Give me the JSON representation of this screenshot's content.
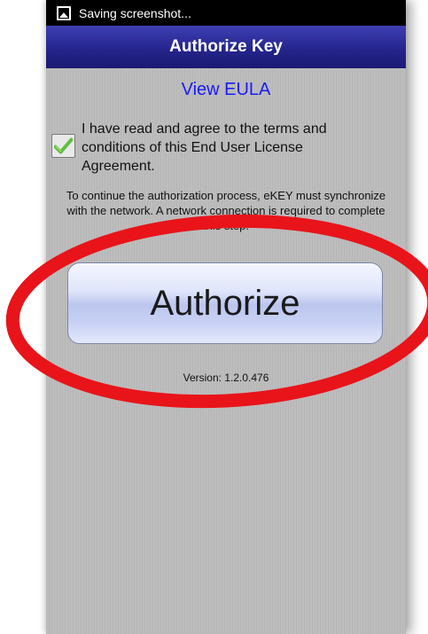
{
  "status_bar": {
    "text": "Saving screenshot...",
    "icon": "screenshot-icon"
  },
  "header": {
    "title": "Authorize Key"
  },
  "eula": {
    "link_label": "View EULA"
  },
  "agreement": {
    "checked": true,
    "text": "I have read and agree to the terms and conditions of this End User License Agreement."
  },
  "info": {
    "text": "To continue the authorization process, eKEY must synchronize with the network. A network connection is required to complete this step."
  },
  "actions": {
    "authorize_label": "Authorize"
  },
  "footer": {
    "version": "Version: 1.2.0.476"
  },
  "colors": {
    "header_bg": "#23238a",
    "link": "#1a1aff",
    "annotation_circle": "#e8141a",
    "check": "#5fbf3f"
  }
}
